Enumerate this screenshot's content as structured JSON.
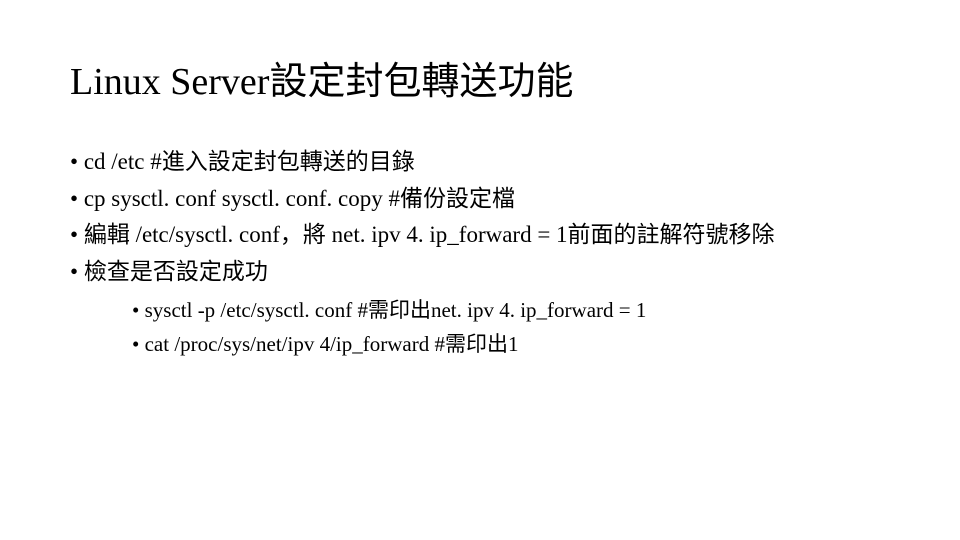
{
  "title": "Linux Server設定封包轉送功能",
  "bullets": [
    "cd /etc  #進入設定封包轉送的目錄",
    "cp sysctl. conf sysctl. conf. copy  #備份設定檔",
    "編輯 /etc/sysctl. conf，將 net. ipv 4. ip_forward = 1前面的註解符號移除",
    "檢查是否設定成功"
  ],
  "subbullets": [
    "sysctl -p /etc/sysctl. conf  #需印出net. ipv 4. ip_forward = 1",
    "cat /proc/sys/net/ipv 4/ip_forward  #需印出1"
  ]
}
